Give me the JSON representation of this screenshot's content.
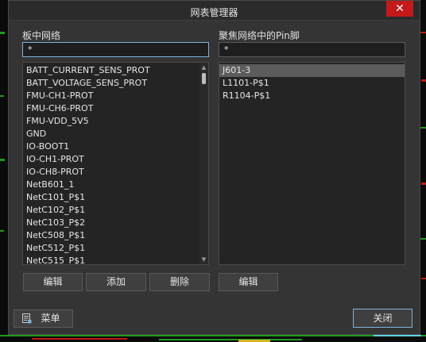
{
  "title": "网表管理器",
  "close_icon_glyph": "✕",
  "left_panel": {
    "label": "板中网络",
    "search_value": "*",
    "items": [
      "BATT_CURRENT_SENS_PROT",
      "BATT_VOLTAGE_SENS_PROT",
      "FMU-CH1-PROT",
      "FMU-CH6-PROT",
      "FMU-VDD_5V5",
      "GND",
      "IO-BOOT1",
      "IO-CH1-PROT",
      "IO-CH8-PROT",
      "NetB601_1",
      "NetC101_P$1",
      "NetC102_P$1",
      "NetC103_P$2",
      "NetC508_P$1",
      "NetC512_P$1",
      "NetC515_P$1"
    ],
    "buttons": {
      "edit": "编辑",
      "add": "添加",
      "delete": "删除"
    }
  },
  "right_panel": {
    "label": "聚焦网络中的Pin脚",
    "search_value": "*",
    "items": [
      "J601-3",
      "L1101-P$1",
      "R1104-P$1"
    ],
    "selected_index": 0,
    "buttons": {
      "edit": "编辑"
    }
  },
  "footer": {
    "menu_label": "菜单",
    "close_label": "关闭"
  },
  "colors": {
    "accent_border": "#7fb2d6",
    "close_red": "#c21a1a",
    "dialog_bg": "#343434"
  }
}
